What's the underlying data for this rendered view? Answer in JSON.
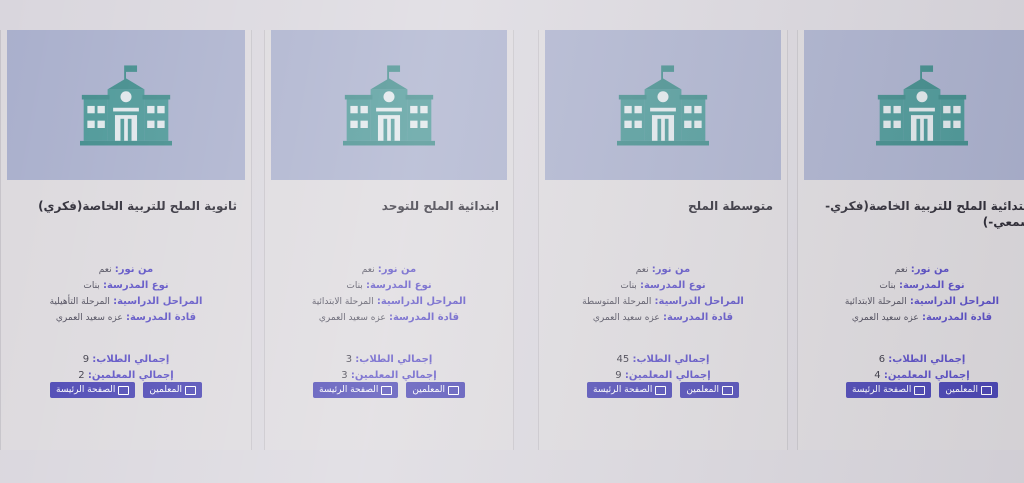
{
  "colors": {
    "accent": "#4a45b3",
    "label": "#5a4ec4",
    "image_bg": "#a9afcc",
    "icon": "#4a8f8f"
  },
  "labels": {
    "principal": "من نور:",
    "school_type": "نوع المدرسة:",
    "stages": "المراحل الدراسية:",
    "leaders": "قادة المدرسة:",
    "total_students": "إجمالي الطلاب:",
    "total_teachers": "إجمالي المعلمين:"
  },
  "buttons": {
    "teachers": "المعلمين",
    "home": "الصفحة الرئيسة"
  },
  "cards": [
    {
      "title": "ابتدائية الملح للتربية الخاصة(فكري-سمعي-)",
      "principal": "نعم",
      "school_type": "بنات",
      "stages": "المرحلة الابتدائية",
      "leaders": "عزه سعيد العمري",
      "total_students": "6",
      "total_teachers": "4"
    },
    {
      "title": "متوسطة الملح",
      "principal": "نعم",
      "school_type": "بنات",
      "stages": "المرحلة المتوسطة",
      "leaders": "عزه سعيد العمري",
      "total_students": "45",
      "total_teachers": "9"
    },
    {
      "title": "ابتدائية الملح للتوحد",
      "principal": "نعم",
      "school_type": "بنات",
      "stages": "المرحلة الابتدائية",
      "leaders": "عزه سعيد العمري",
      "total_students": "3",
      "total_teachers": "3"
    },
    {
      "title": "ثانوية الملح للتربية الخاصة(فكري)",
      "principal": "نعم",
      "school_type": "بنات",
      "stages": "المرحلة التأهيلية",
      "leaders": "عزه سعيد العمري",
      "total_students": "9",
      "total_teachers": "2"
    }
  ]
}
